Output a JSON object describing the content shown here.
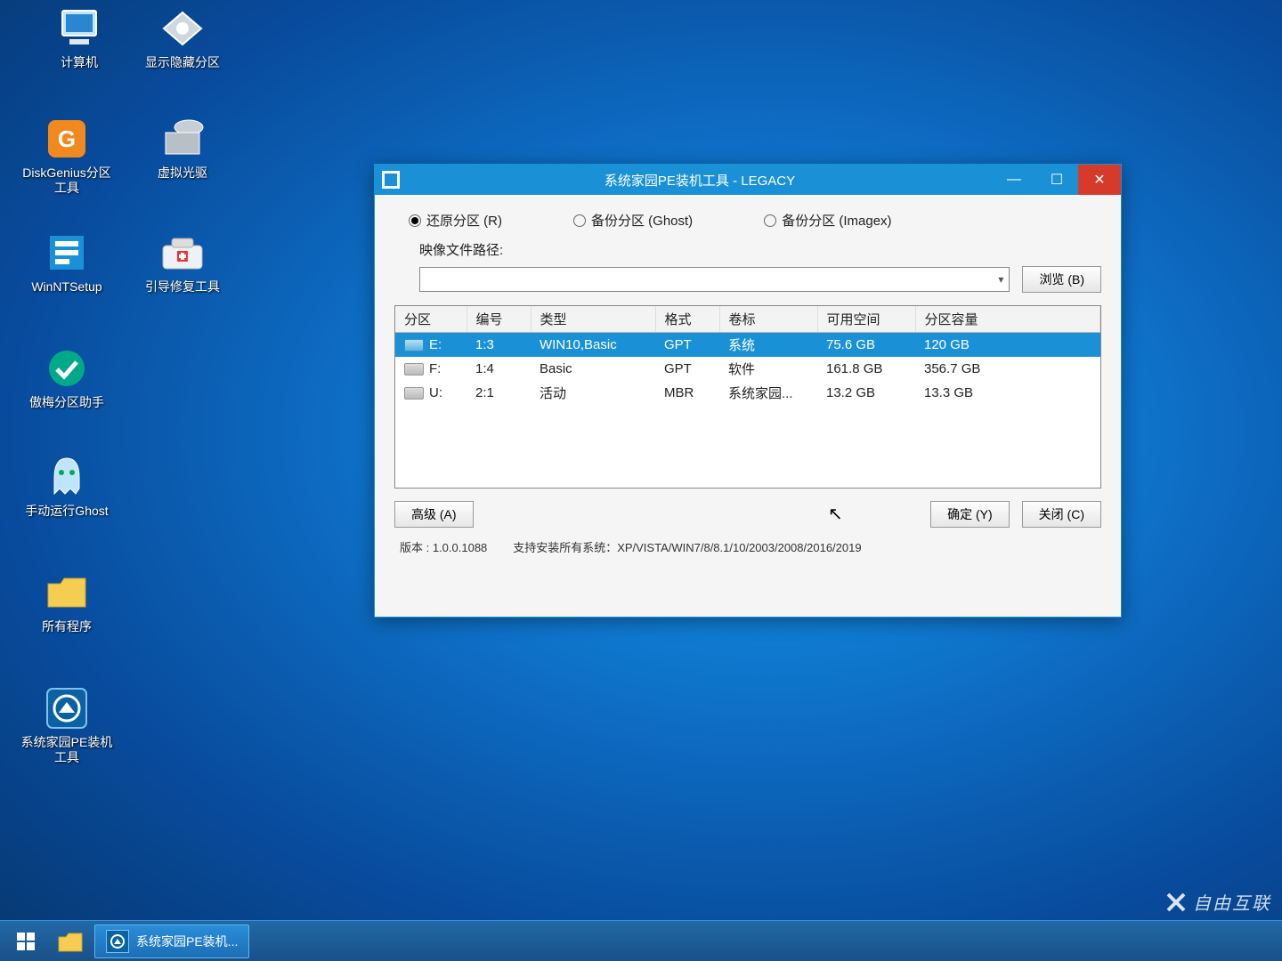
{
  "desktop_icons": [
    {
      "key": "computer",
      "label": "计算机"
    },
    {
      "key": "show-hidden-part",
      "label": "显示隐藏分区"
    },
    {
      "key": "diskgenius",
      "label": "DiskGenius分区工具"
    },
    {
      "key": "virtual-cd",
      "label": "虚拟光驱"
    },
    {
      "key": "winntsetup",
      "label": "WinNTSetup"
    },
    {
      "key": "boot-repair",
      "label": "引导修复工具"
    },
    {
      "key": "aomei",
      "label": "傲梅分区助手"
    },
    {
      "key": "ghost",
      "label": "手动运行Ghost"
    },
    {
      "key": "all-programs",
      "label": "所有程序"
    },
    {
      "key": "pe-tool",
      "label": "系统家园PE装机 工具"
    }
  ],
  "taskbar": {
    "app_label": "系统家园PE装机..."
  },
  "window": {
    "title": "系统家园PE装机工具 - LEGACY",
    "radios": {
      "restore": "还原分区 (R)",
      "backup_ghost": "备份分区 (Ghost)",
      "backup_imagex": "备份分区 (Imagex)"
    },
    "path_label": "映像文件路径:",
    "browse": "浏览 (B)",
    "table": {
      "headers": {
        "partition": "分区",
        "number": "编号",
        "type": "类型",
        "format": "格式",
        "label": "卷标",
        "free": "可用空间",
        "size": "分区容量"
      },
      "rows": [
        {
          "drive": "E:",
          "num": "1:3",
          "type": "WIN10,Basic",
          "format": "GPT",
          "label": "系统",
          "free": "75.6 GB",
          "size": "120 GB",
          "sel": true
        },
        {
          "drive": "F:",
          "num": "1:4",
          "type": "Basic",
          "format": "GPT",
          "label": "软件",
          "free": "161.8 GB",
          "size": "356.7 GB",
          "sel": false
        },
        {
          "drive": "U:",
          "num": "2:1",
          "type": "活动",
          "format": "MBR",
          "label": "系统家园...",
          "free": "13.2 GB",
          "size": "13.3 GB",
          "sel": false
        }
      ]
    },
    "advanced": "高级 (A)",
    "ok": "确定 (Y)",
    "close": "关闭 (C)",
    "version_label": "版本 : 1.0.0.1088",
    "support_label": "支持安装所有系统：XP/VISTA/WIN7/8/8.1/10/2003/2008/2016/2019"
  },
  "watermark": "自由互联"
}
